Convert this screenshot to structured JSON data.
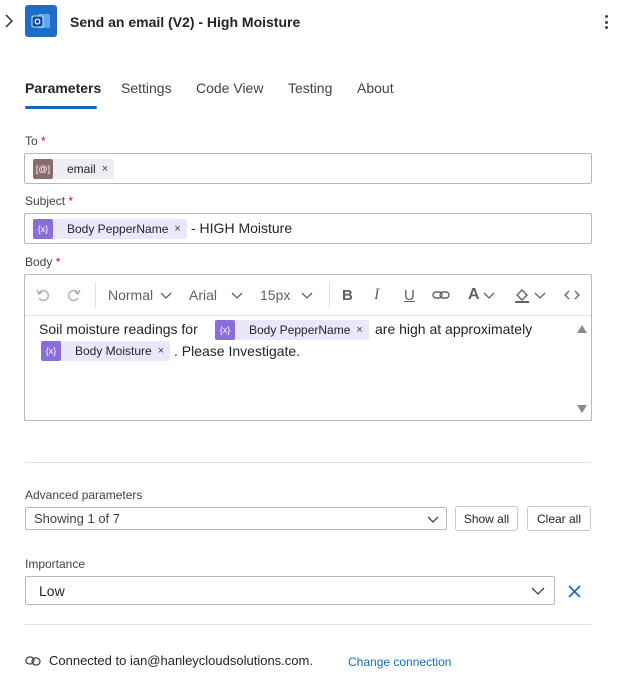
{
  "header": {
    "title": "Send an email (V2) - High Moisture",
    "app_icon": "outlook-icon",
    "expand_icon": "chevron-right-icon",
    "more_icon": "more-vertical-icon"
  },
  "tabs": [
    {
      "label": "Parameters",
      "active": true
    },
    {
      "label": "Settings",
      "active": false
    },
    {
      "label": "Code View",
      "active": false
    },
    {
      "label": "Testing",
      "active": false
    },
    {
      "label": "About",
      "active": false
    }
  ],
  "fields": {
    "to": {
      "label": "To",
      "required_mark": "*",
      "token": "email"
    },
    "subject": {
      "label": "Subject",
      "required_mark": "*",
      "token": "Body PepperName",
      "suffix": "- HIGH Moisture"
    },
    "body": {
      "label": "Body",
      "required_mark": "*",
      "toolbar": {
        "format": "Normal",
        "font": "Arial",
        "size": "15px"
      },
      "line1_prefix": "Soil moisture readings for",
      "line1_token": "Body PepperName",
      "line1_suffix": "are high at approximately",
      "line2_token": "Body Moisture",
      "line2_suffix": ". Please Investigate."
    }
  },
  "advanced": {
    "label": "Advanced parameters",
    "select_value": "Showing 1 of 7",
    "show_all": "Show all",
    "clear_all": "Clear all"
  },
  "importance": {
    "label": "Importance",
    "value": "Low"
  },
  "connection": {
    "text": "Connected to ian@hanleycloudsolutions.com.",
    "change_link": "Change connection"
  },
  "token_close": "×",
  "colors": {
    "accent": "#0f6cbd",
    "required": "#c50f1f",
    "token_purple": "#8a6ddc",
    "token_brown": "#8a6a6a",
    "app_icon_bg": "#1e6ec7"
  }
}
